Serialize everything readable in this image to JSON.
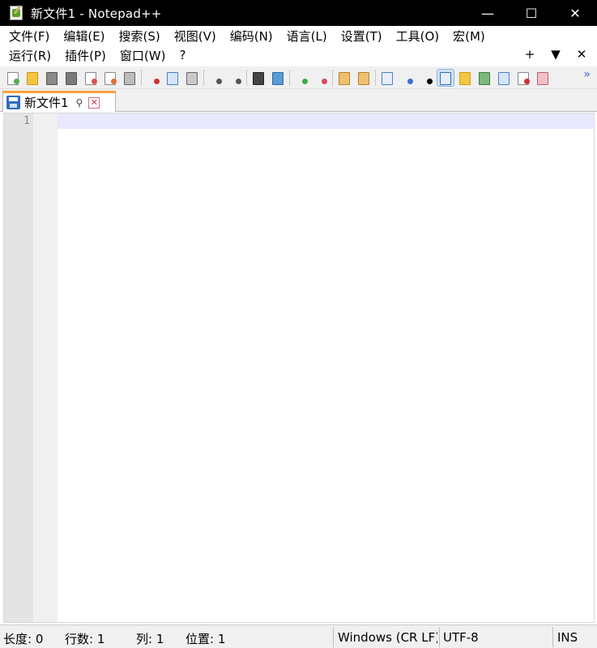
{
  "window": {
    "title": "新文件1 - Notepad++",
    "minimize_glyph": "—",
    "maximize_glyph": "☐",
    "close_glyph": "✕",
    "app_icon": "notepad-plus-plus-icon"
  },
  "menu": {
    "row1": [
      "文件(F)",
      "编辑(E)",
      "搜索(S)",
      "视图(V)",
      "编码(N)",
      "语言(L)",
      "设置(T)",
      "工具(O)",
      "宏(M)"
    ],
    "row2": [
      "运行(R)",
      "插件(P)",
      "窗口(W)",
      "?"
    ],
    "right": {
      "add": "+",
      "dropdown": "▼",
      "close": "✕"
    }
  },
  "toolbar": {
    "more_glyph": "»",
    "buttons": [
      "new-file-icon",
      "open-file-icon",
      "save-icon",
      "save-all-icon",
      "close-icon",
      "close-all-icon",
      "print-icon",
      "cut-icon",
      "copy-icon",
      "paste-icon",
      "undo-icon",
      "redo-icon",
      "find-icon",
      "replace-icon",
      "zoom-in-icon",
      "zoom-out-icon",
      "sync-vertical-icon",
      "sync-horizontal-icon",
      "word-wrap-icon",
      "show-all-characters-icon",
      "indent-guide-icon",
      "document-map-icon",
      "function-list-icon",
      "folder-as-workspace-icon",
      "record-macro-icon",
      "stop-recording-icon"
    ]
  },
  "tab": {
    "label": "新文件1",
    "pin_glyph": "📌",
    "close_glyph": "✕",
    "accent_color": "#f7a23c"
  },
  "editor": {
    "line_numbers": [
      "1"
    ],
    "content": ""
  },
  "status": {
    "length": "长度: 0",
    "lines": "行数: 1",
    "column": "列: 1",
    "position": "位置: 1",
    "eol": "Windows (CR LF)",
    "encoding": "UTF-8",
    "mode": "INS"
  }
}
